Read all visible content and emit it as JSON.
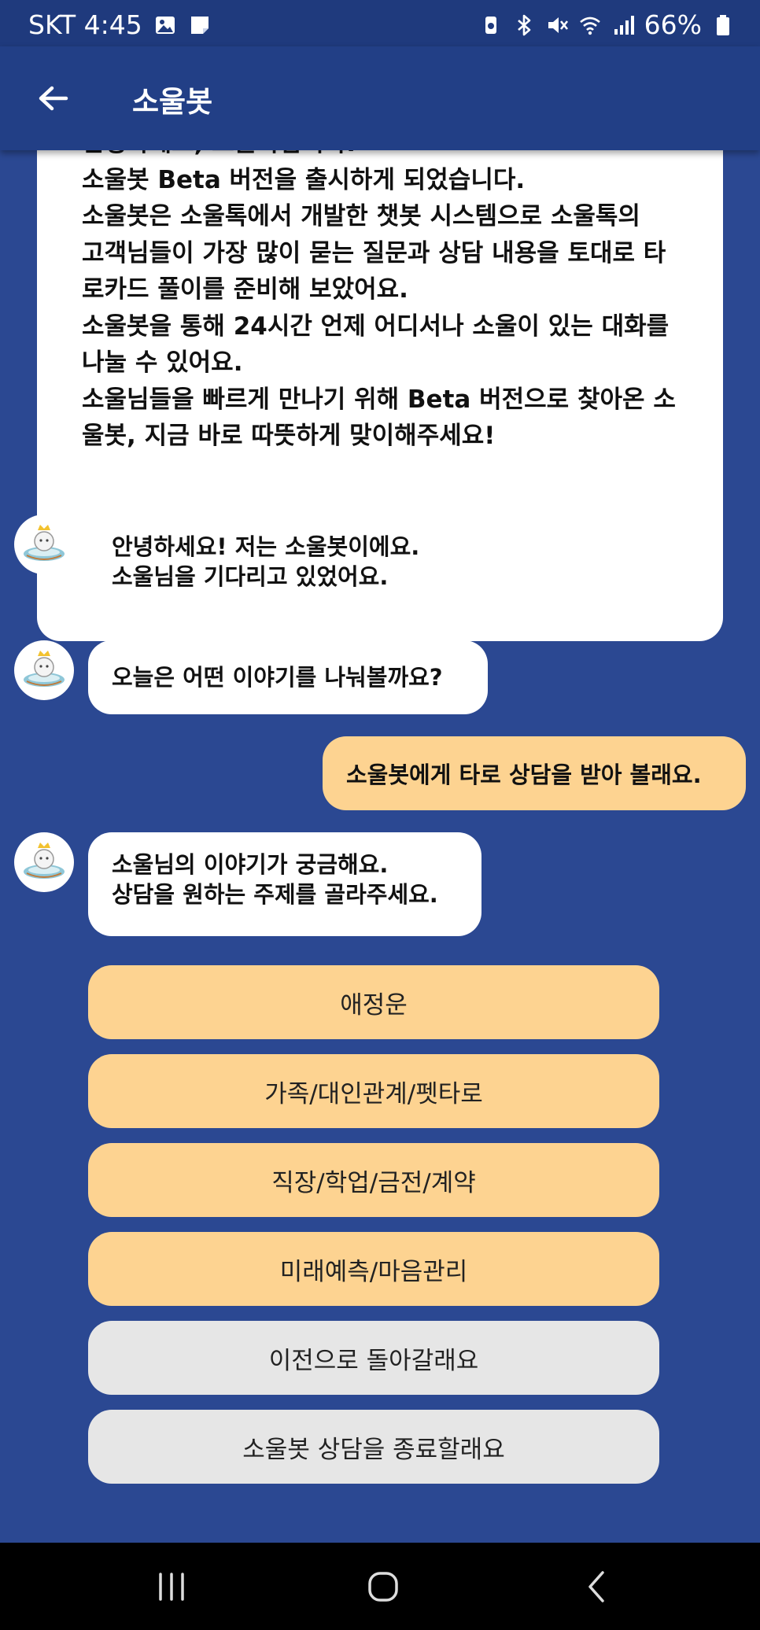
{
  "status_bar": {
    "carrier_time": "SKT 4:45",
    "battery": "66%",
    "icons": [
      "gallery-icon",
      "note-icon",
      "battery-saver-icon",
      "bluetooth-icon",
      "mute-icon",
      "wifi-icon",
      "signal-icon",
      "battery-icon"
    ]
  },
  "app_bar": {
    "title": "소울봇",
    "back_icon": "back-arrow-icon"
  },
  "intro_message": {
    "lines": [
      "안녕하세요, 소울톡입니다.",
      "소울봇 Beta 버전을 출시하게 되었습니다.",
      "소울봇은 소울톡에서 개발한 챗봇 시스템으로 소울톡의",
      "고객님들이 가장 많이 묻는 질문과 상담 내용을 토대로 타",
      "로카드 풀이를 준비해 보았어요.",
      "소울봇을 통해 24시간 언제 어디서나 소울이 있는 대화를",
      "나눌 수 있어요.",
      "소울님들을 빠르게 만나기 위해 Beta 버전으로 찾아온 소",
      "울봇, 지금 바로 따뜻하게 맞이해주세요!"
    ]
  },
  "messages": [
    {
      "sender": "bot",
      "lines": [
        "안녕하세요! 저는 소울봇이에요.",
        "소울님을 기다리고 있었어요."
      ]
    },
    {
      "sender": "bot",
      "lines": [
        "오늘은 어떤 이야기를 나눠볼까요?"
      ]
    },
    {
      "sender": "user",
      "lines": [
        "소울봇에게 타로 상담을 받아 볼래요."
      ]
    },
    {
      "sender": "bot",
      "lines": [
        "소울님의 이야기가 궁금해요.",
        "상담을 원하는 주제를 골라주세요."
      ]
    }
  ],
  "options": [
    {
      "label": "애정운",
      "style": "orange"
    },
    {
      "label": "가족/대인관계/펫타로",
      "style": "orange"
    },
    {
      "label": "직장/학업/금전/계약",
      "style": "orange"
    },
    {
      "label": "미래예측/마음관리",
      "style": "orange"
    },
    {
      "label": "이전으로 돌아갈래요",
      "style": "gray"
    },
    {
      "label": "소울봇 상담을 종료할래요",
      "style": "gray"
    }
  ],
  "colors": {
    "background": "#2b4892",
    "app_bar": "#223f86",
    "bot_bubble": "#ffffff",
    "user_bubble": "#fdd391",
    "option_orange": "#fdd391",
    "option_gray": "#e6e6e6"
  },
  "nav_bar": {
    "icons": [
      "recent-apps-icon",
      "home-icon",
      "back-icon"
    ]
  }
}
